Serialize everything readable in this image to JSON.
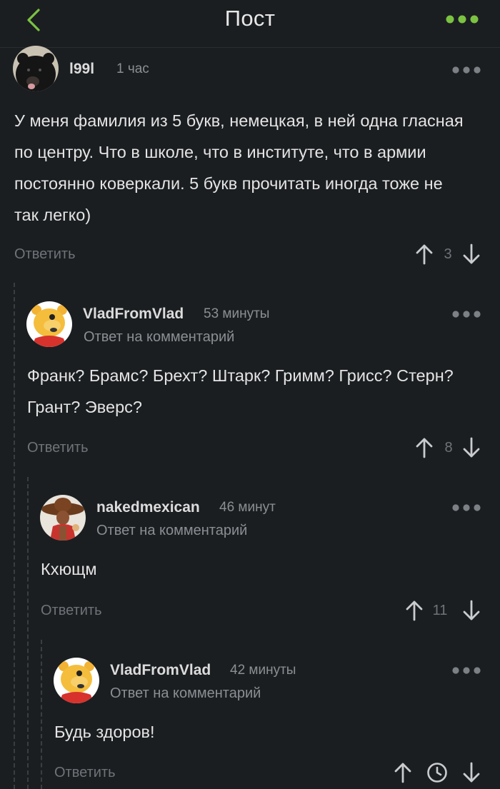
{
  "header": {
    "title": "Пост",
    "accent_color": "#7bc242"
  },
  "comments": [
    {
      "username": "l99l",
      "time": "1 час",
      "reply_note": "",
      "text": "У меня фамилия из 5 букв, немецкая, в ней одна гласная по центру. Что в школе, что в институте, что в армии постоянно коверкали. 5 букв прочитать иногда тоже не так легко)",
      "reply_label": "Ответить",
      "score": "3",
      "avatar_icon": "bear-avatar"
    },
    {
      "username": "VladFromVlad",
      "time": "53 минуты",
      "reply_note": "Ответ на комментарий",
      "text": "Франк? Брамс? Брехт? Штарк? Гримм? Грисс? Стерн? Грант? Эверс?",
      "reply_label": "Ответить",
      "score": "8",
      "avatar_icon": "yellow-bear-avatar"
    },
    {
      "username": "nakedmexican",
      "time": "46 минут",
      "reply_note": "Ответ на комментарий",
      "text": "Кхющм",
      "reply_label": "Ответить",
      "score": "11",
      "avatar_icon": "sombrero-man-avatar"
    },
    {
      "username": "VladFromVlad",
      "time": "42 минуты",
      "reply_note": "Ответ на комментарий",
      "text": "Будь здоров!",
      "reply_label": "Ответить",
      "score": "",
      "avatar_icon": "yellow-bear-avatar"
    }
  ]
}
